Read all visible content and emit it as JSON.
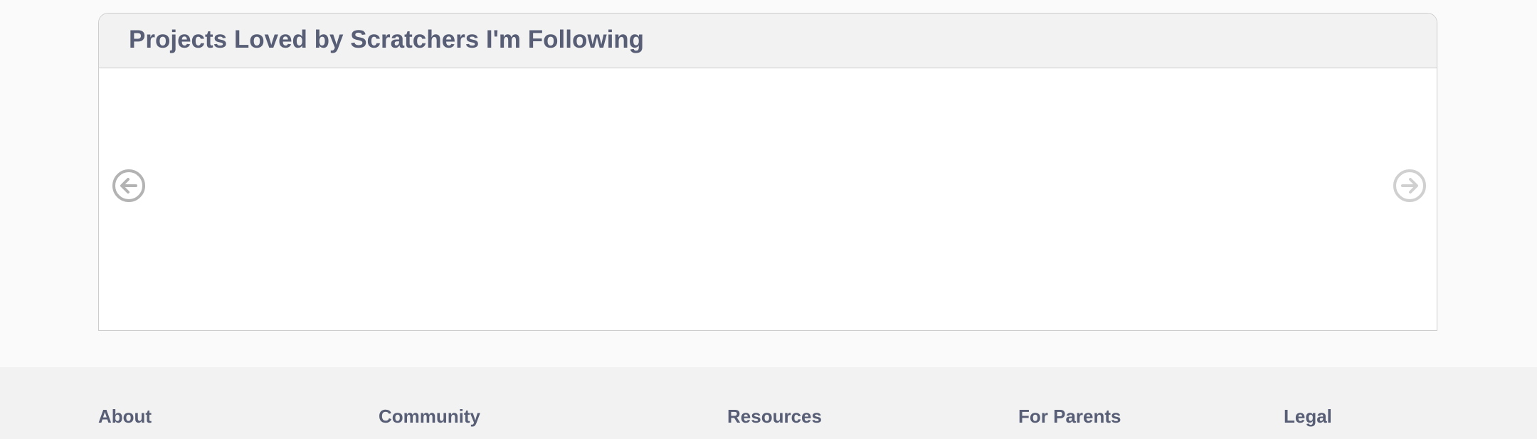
{
  "projects_section": {
    "title": "Projects Loved by Scratchers I'm Following",
    "prev_icon": "arrow-left-circle-icon",
    "next_icon": "arrow-right-circle-icon",
    "prev_color": "#b3b3b3",
    "next_color": "#d0d0d0"
  },
  "footer": {
    "headings": [
      "About",
      "Community",
      "Resources",
      "For Parents",
      "Legal"
    ]
  },
  "colors": {
    "heading_text": "#575e75",
    "page_background": "#fafafa",
    "footer_background": "#f2f2f2",
    "box_border": "#cdcdcd"
  }
}
